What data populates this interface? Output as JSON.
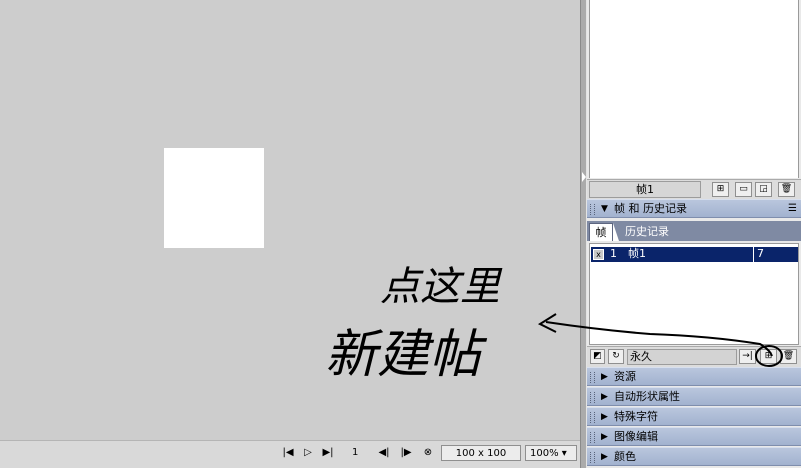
{
  "canvas": {
    "background": "#cdcdcd",
    "doc_color": "#ffffff"
  },
  "status": {
    "frame_number": "1",
    "size": "100 x 100",
    "zoom": "100%",
    "zoom_arrow": "▾"
  },
  "frames_toolbar": {
    "frame_name": "帧1"
  },
  "frames_panel": {
    "title": "帧 和 历史记录",
    "tab_frames": "帧",
    "tab_history": "历史记录",
    "rows": [
      {
        "number": "1",
        "name": "帧1",
        "delay": "7"
      }
    ],
    "loop": "永久"
  },
  "collapsed_panels": [
    {
      "title": "资源"
    },
    {
      "title": "自动形状属性"
    },
    {
      "title": "特殊字符"
    },
    {
      "title": "图像编辑"
    },
    {
      "title": "颜色"
    }
  ],
  "annotation": {
    "line1": "点这里",
    "line2": "新建帖",
    "ink": "#000000"
  },
  "icons": [
    "first-frame-icon",
    "play-icon",
    "last-frame-icon",
    "prev-frame-icon",
    "next-frame-icon",
    "stop-icon",
    "add-frame-icon",
    "delete-icon",
    "options-menu-icon"
  ]
}
